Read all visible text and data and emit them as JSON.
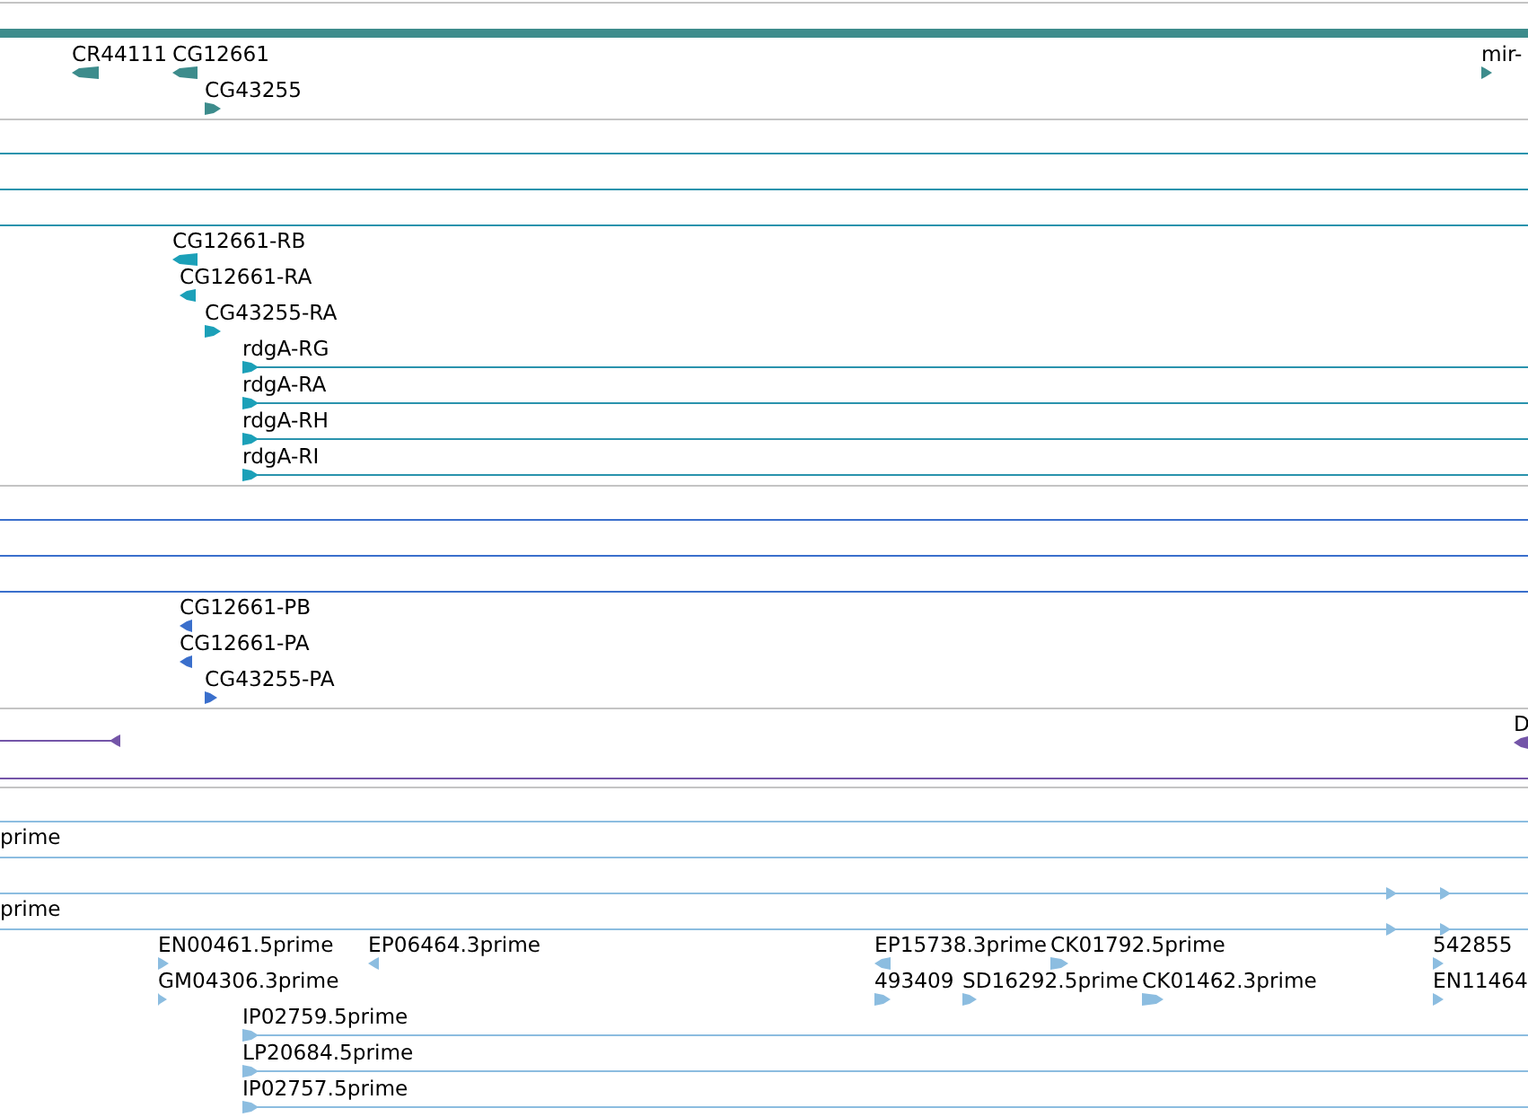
{
  "tracks": [
    {
      "features": [
        {
          "label": "CR44111",
          "reverse": true
        },
        {
          "label": "CG12661",
          "reverse": true
        },
        {
          "label": "CG43255",
          "reverse": false
        },
        {
          "label": "mir-",
          "reverse": false
        }
      ]
    },
    {
      "features": [
        {
          "label": "CG12661-RB",
          "reverse": true
        },
        {
          "label": "CG12661-RA",
          "reverse": true
        },
        {
          "label": "CG43255-RA",
          "reverse": false
        },
        {
          "label": "rdgA-RG",
          "reverse": false
        },
        {
          "label": "rdgA-RA",
          "reverse": false
        },
        {
          "label": "rdgA-RH",
          "reverse": false
        },
        {
          "label": "rdgA-RI",
          "reverse": false
        }
      ]
    },
    {
      "features": [
        {
          "label": "CG12661-PB",
          "reverse": true
        },
        {
          "label": "CG12661-PA",
          "reverse": true
        },
        {
          "label": "CG43255-PA",
          "reverse": false
        }
      ]
    },
    {
      "features": [
        {
          "label": "D",
          "reverse": true
        }
      ]
    },
    {
      "features": [
        {
          "label": "prime"
        },
        {
          "label": "prime"
        },
        {
          "label": "EN00461.5prime",
          "reverse": false
        },
        {
          "label": "EP06464.3prime",
          "reverse": true
        },
        {
          "label": "EP15738.3prime",
          "reverse": true
        },
        {
          "label": "CK01792.5prime",
          "reverse": false
        },
        {
          "label": "542855",
          "reverse": false
        },
        {
          "label": "GM04306.3prime",
          "reverse": false
        },
        {
          "label": "493409",
          "reverse": false
        },
        {
          "label": "SD16292.5prime",
          "reverse": false
        },
        {
          "label": "CK01462.3prime",
          "reverse": false
        },
        {
          "label": "EN11464",
          "reverse": false
        },
        {
          "label": "IP02759.5prime",
          "reverse": false
        },
        {
          "label": "LP20684.5prime",
          "reverse": false
        },
        {
          "label": "IP02757.5prime",
          "reverse": false
        }
      ]
    }
  ]
}
